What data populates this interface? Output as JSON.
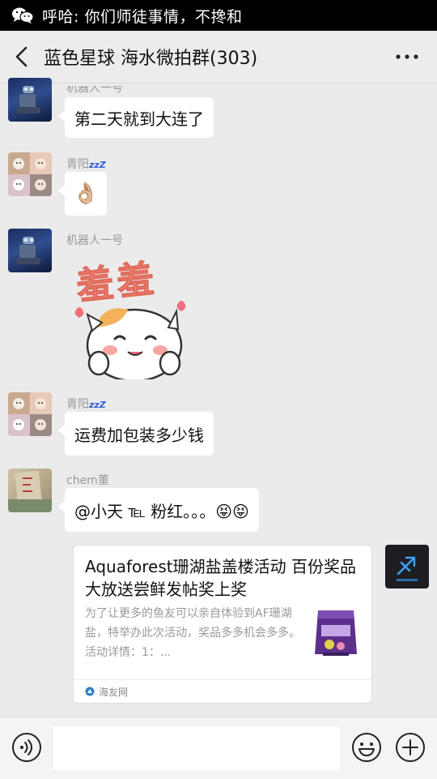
{
  "notification": {
    "text": "呼哈: 你们师徒事情，不搀和"
  },
  "header": {
    "title": "蓝色星球 海水微拍群(303)"
  },
  "messages": [
    {
      "sender": "机器人一号",
      "text": "第二天就到大连了"
    },
    {
      "sender": "青阳",
      "sender_badge": "zzZ",
      "emoji": "👌🏼"
    },
    {
      "sender": "机器人一号",
      "sticker_text": "羞羞"
    },
    {
      "sender": "青阳",
      "sender_badge": "zzZ",
      "text": "运费加包装多少钱"
    },
    {
      "sender": "chem董",
      "text": "@小天 ℡ 粉红。。。😝😝"
    }
  ],
  "link_card": {
    "title": "Aquaforest珊湖盐盖楼活动 百份奖品大放送尝鲜发帖奖上奖",
    "description": "为了让更多的鱼友可以亲自体验到AF珊湖盐，特举办此次活动，奖品多多机会多多。活动详情：1：...",
    "source": "海友网"
  },
  "icons": {
    "wechat": "wechat-icon",
    "back": "back-arrow-icon",
    "more": "more-dots-icon",
    "voice": "voice-icon",
    "emoji": "emoji-icon",
    "plus": "plus-icon"
  },
  "colors": {
    "notification_bg": "#000000",
    "chat_bg": "#ebebeb",
    "bubble": "#ffffff"
  }
}
